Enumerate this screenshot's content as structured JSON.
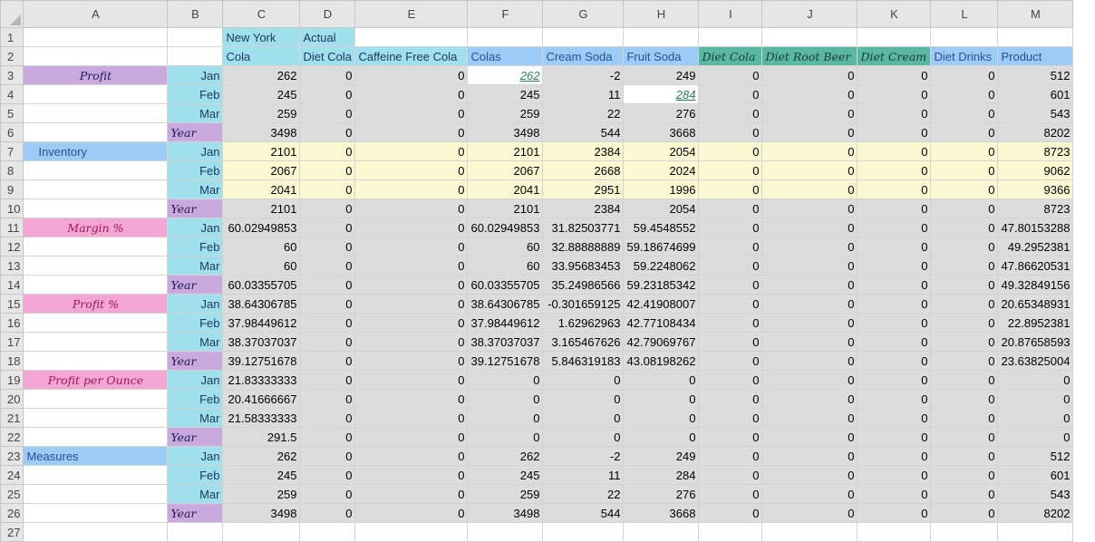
{
  "columns": [
    "A",
    "B",
    "C",
    "D",
    "E",
    "F",
    "G",
    "H",
    "I",
    "J",
    "K",
    "L",
    "M"
  ],
  "header_row1": {
    "C": "New York",
    "D": "Actual"
  },
  "header_row2": {
    "C": "Cola",
    "D": "Diet Cola",
    "E": "Caffeine Free Cola",
    "F": "Colas",
    "G": "Cream Soda",
    "H": "Fruit Soda",
    "I": "Diet Cola",
    "J": "Diet Root Beer",
    "K": "Diet Cream",
    "L": "Diet Drinks",
    "M": "Product"
  },
  "rows": [
    {
      "n": "3",
      "a": "Profit",
      "b": "Jan",
      "v": [
        "262",
        "0",
        "0",
        "262",
        "-2",
        "249",
        "0",
        "0",
        "0",
        "0",
        "512"
      ]
    },
    {
      "n": "4",
      "a": "",
      "b": "Feb",
      "v": [
        "245",
        "0",
        "0",
        "245",
        "11",
        "284",
        "0",
        "0",
        "0",
        "0",
        "601"
      ]
    },
    {
      "n": "5",
      "a": "",
      "b": "Mar",
      "v": [
        "259",
        "0",
        "0",
        "259",
        "22",
        "276",
        "0",
        "0",
        "0",
        "0",
        "543"
      ]
    },
    {
      "n": "6",
      "a": "",
      "b": "Year",
      "v": [
        "3498",
        "0",
        "0",
        "3498",
        "544",
        "3668",
        "0",
        "0",
        "0",
        "0",
        "8202"
      ]
    },
    {
      "n": "7",
      "a": "Inventory",
      "b": "Jan",
      "v": [
        "2101",
        "0",
        "0",
        "2101",
        "2384",
        "2054",
        "0",
        "0",
        "0",
        "0",
        "8723"
      ]
    },
    {
      "n": "8",
      "a": "",
      "b": "Feb",
      "v": [
        "2067",
        "0",
        "0",
        "2067",
        "2668",
        "2024",
        "0",
        "0",
        "0",
        "0",
        "9062"
      ]
    },
    {
      "n": "9",
      "a": "",
      "b": "Mar",
      "v": [
        "2041",
        "0",
        "0",
        "2041",
        "2951",
        "1996",
        "0",
        "0",
        "0",
        "0",
        "9366"
      ]
    },
    {
      "n": "10",
      "a": "",
      "b": "Year",
      "v": [
        "2101",
        "0",
        "0",
        "2101",
        "2384",
        "2054",
        "0",
        "0",
        "0",
        "0",
        "8723"
      ]
    },
    {
      "n": "11",
      "a": "Margin %",
      "b": "Jan",
      "v": [
        "60.02949853",
        "0",
        "0",
        "60.02949853",
        "31.82503771",
        "59.4548552",
        "0",
        "0",
        "0",
        "0",
        "47.80153288"
      ]
    },
    {
      "n": "12",
      "a": "",
      "b": "Feb",
      "v": [
        "60",
        "0",
        "0",
        "60",
        "32.88888889",
        "59.18674699",
        "0",
        "0",
        "0",
        "0",
        "49.2952381"
      ]
    },
    {
      "n": "13",
      "a": "",
      "b": "Mar",
      "v": [
        "60",
        "0",
        "0",
        "60",
        "33.95683453",
        "59.2248062",
        "0",
        "0",
        "0",
        "0",
        "47.86620531"
      ]
    },
    {
      "n": "14",
      "a": "",
      "b": "Year",
      "v": [
        "60.03355705",
        "0",
        "0",
        "60.03355705",
        "35.24986566",
        "59.23185342",
        "0",
        "0",
        "0",
        "0",
        "49.32849156"
      ]
    },
    {
      "n": "15",
      "a": "Profit %",
      "b": "Jan",
      "v": [
        "38.64306785",
        "0",
        "0",
        "38.64306785",
        "-0.301659125",
        "42.41908007",
        "0",
        "0",
        "0",
        "0",
        "20.65348931"
      ]
    },
    {
      "n": "16",
      "a": "",
      "b": "Feb",
      "v": [
        "37.98449612",
        "0",
        "0",
        "37.98449612",
        "1.62962963",
        "42.77108434",
        "0",
        "0",
        "0",
        "0",
        "22.8952381"
      ]
    },
    {
      "n": "17",
      "a": "",
      "b": "Mar",
      "v": [
        "38.37037037",
        "0",
        "0",
        "38.37037037",
        "3.165467626",
        "42.79069767",
        "0",
        "0",
        "0",
        "0",
        "20.87658593"
      ]
    },
    {
      "n": "18",
      "a": "",
      "b": "Year",
      "v": [
        "39.12751678",
        "0",
        "0",
        "39.12751678",
        "5.846319183",
        "43.08198262",
        "0",
        "0",
        "0",
        "0",
        "23.63825004"
      ]
    },
    {
      "n": "19",
      "a": "Profit per Ounce",
      "b": "Jan",
      "v": [
        "21.83333333",
        "0",
        "0",
        "0",
        "0",
        "0",
        "0",
        "0",
        "0",
        "0",
        "0"
      ]
    },
    {
      "n": "20",
      "a": "",
      "b": "Feb",
      "v": [
        "20.41666667",
        "0",
        "0",
        "0",
        "0",
        "0",
        "0",
        "0",
        "0",
        "0",
        "0"
      ]
    },
    {
      "n": "21",
      "a": "",
      "b": "Mar",
      "v": [
        "21.58333333",
        "0",
        "0",
        "0",
        "0",
        "0",
        "0",
        "0",
        "0",
        "0",
        "0"
      ]
    },
    {
      "n": "22",
      "a": "",
      "b": "Year",
      "v": [
        "291.5",
        "0",
        "0",
        "0",
        "0",
        "0",
        "0",
        "0",
        "0",
        "0",
        "0"
      ]
    },
    {
      "n": "23",
      "a": "Measures",
      "b": "Jan",
      "v": [
        "262",
        "0",
        "0",
        "262",
        "-2",
        "249",
        "0",
        "0",
        "0",
        "0",
        "512"
      ]
    },
    {
      "n": "24",
      "a": "",
      "b": "Feb",
      "v": [
        "245",
        "0",
        "0",
        "245",
        "11",
        "284",
        "0",
        "0",
        "0",
        "0",
        "601"
      ]
    },
    {
      "n": "25",
      "a": "",
      "b": "Mar",
      "v": [
        "259",
        "0",
        "0",
        "259",
        "22",
        "276",
        "0",
        "0",
        "0",
        "0",
        "543"
      ]
    },
    {
      "n": "26",
      "a": "",
      "b": "Year",
      "v": [
        "3498",
        "0",
        "0",
        "3498",
        "544",
        "3668",
        "0",
        "0",
        "0",
        "0",
        "8202"
      ]
    },
    {
      "n": "27",
      "a": "",
      "b": "",
      "v": [
        "",
        "",
        "",
        "",
        "",
        "",
        "",
        "",
        "",
        "",
        ""
      ]
    }
  ],
  "colors": {
    "cyan": "#9fe0ec",
    "blue_header": "#9ccbf5",
    "teal_header": "#58b8a2",
    "purple": "#c9a9de",
    "pink": "#f3a6d4",
    "yellow": "#fbf8d2",
    "gray": "#dcdcdc"
  }
}
